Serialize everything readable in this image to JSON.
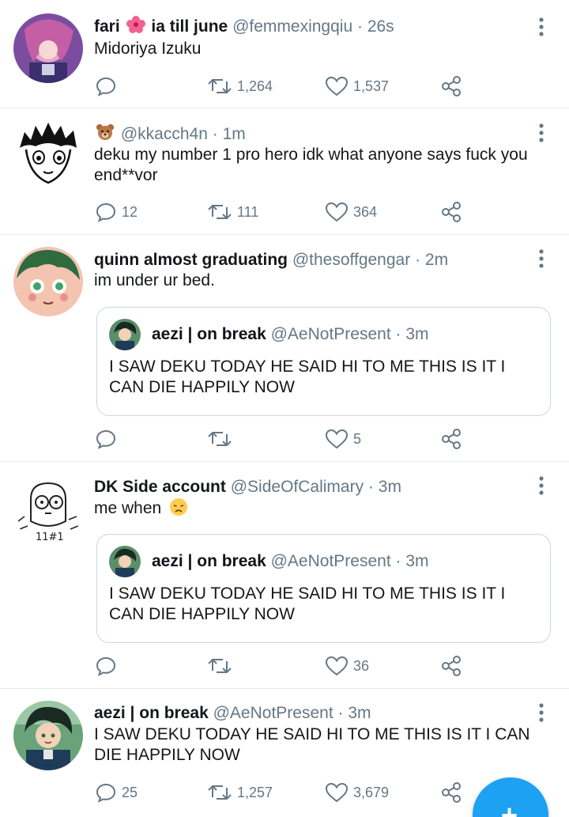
{
  "feed": {
    "tweets": [
      {
        "name": "fari",
        "name_emoji": "hibiscus",
        "name_suffix": "ia till june",
        "handle": "@femmexingqiu",
        "dot": "·",
        "time": "26s",
        "text": "Midoriya Izuku",
        "reply_count": "",
        "retweet_count": "1,264",
        "like_count": "1,537"
      },
      {
        "name_emoji": "bear-face",
        "handle": "@kkacch4n",
        "dot": "·",
        "time": "1m",
        "text": "deku my number 1 pro hero idk what anyone says fuck you end**vor",
        "reply_count": "12",
        "retweet_count": "111",
        "like_count": "364"
      },
      {
        "name": "quinn almost graduating",
        "handle": "@thesoffgengar",
        "dot": "·",
        "time": "2m",
        "text": "im under ur bed.",
        "quote": {
          "name": "aezi | on break",
          "handle": "@AeNotPresent",
          "dot": "·",
          "time": "3m",
          "text": "I SAW DEKU TODAY HE SAID HI TO ME THIS IS IT I CAN DIE HAPPILY NOW"
        },
        "reply_count": "",
        "retweet_count": "",
        "like_count": "5"
      },
      {
        "name": "DK Side account",
        "handle": "@SideOfCalimary",
        "dot": "·",
        "time": "3m",
        "text": "me when",
        "text_emoji": "disappointed-face",
        "quote": {
          "name": "aezi | on break",
          "handle": "@AeNotPresent",
          "dot": "·",
          "time": "3m",
          "text": "I SAW DEKU TODAY HE SAID HI TO ME THIS IS IT I CAN DIE HAPPILY NOW"
        },
        "reply_count": "",
        "retweet_count": "",
        "like_count": "36"
      },
      {
        "name": "aezi | on break",
        "handle": "@AeNotPresent",
        "dot": "·",
        "time": "3m",
        "text": "I SAW DEKU TODAY HE SAID HI TO ME THIS IS IT I CAN DIE HAPPILY NOW",
        "reply_count": "25",
        "retweet_count": "1,257",
        "like_count": "3,679"
      }
    ]
  },
  "compose": {
    "icon": "plus-icon",
    "glyph": "+"
  },
  "colors": {
    "accent": "#1da1f2",
    "secondary_text": "#657786",
    "divider": "#e6ecf0"
  }
}
